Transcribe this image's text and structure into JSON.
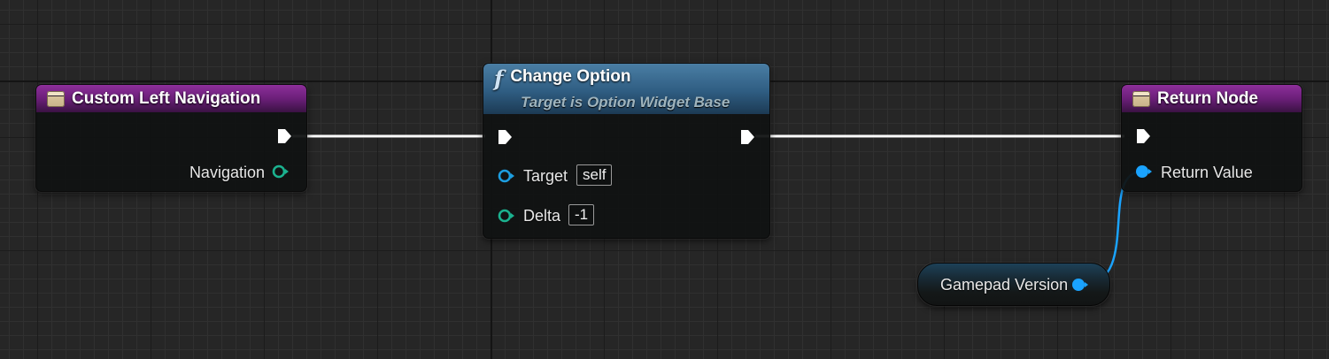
{
  "nodes": {
    "custom_left_navigation": {
      "title": "Custom Left Navigation",
      "outputs": {
        "navigation": "Navigation"
      }
    },
    "change_option": {
      "icon": "f",
      "title": "Change Option",
      "subtitle": "Target is Option Widget Base",
      "inputs": {
        "target": {
          "label": "Target",
          "default": "self"
        },
        "delta": {
          "label": "Delta",
          "default": "-1"
        }
      }
    },
    "return_node": {
      "title": "Return Node",
      "inputs": {
        "return_value": "Return Value"
      }
    },
    "gamepad_version": {
      "label": "Gamepad Version"
    }
  },
  "icons": {
    "entry": "function-entry-icon",
    "function": "function-f-icon",
    "exec": "exec-pin-icon",
    "data": "data-pin-icon"
  },
  "colors": {
    "entry_header": "#7a2688",
    "call_header": "#35648a",
    "exec_wire": "#ffffff",
    "bool_pin": "#1aa3ff",
    "struct_pin": "#1bb28f",
    "object_pin": "#1d9ee0",
    "grid_background": "#262626"
  }
}
